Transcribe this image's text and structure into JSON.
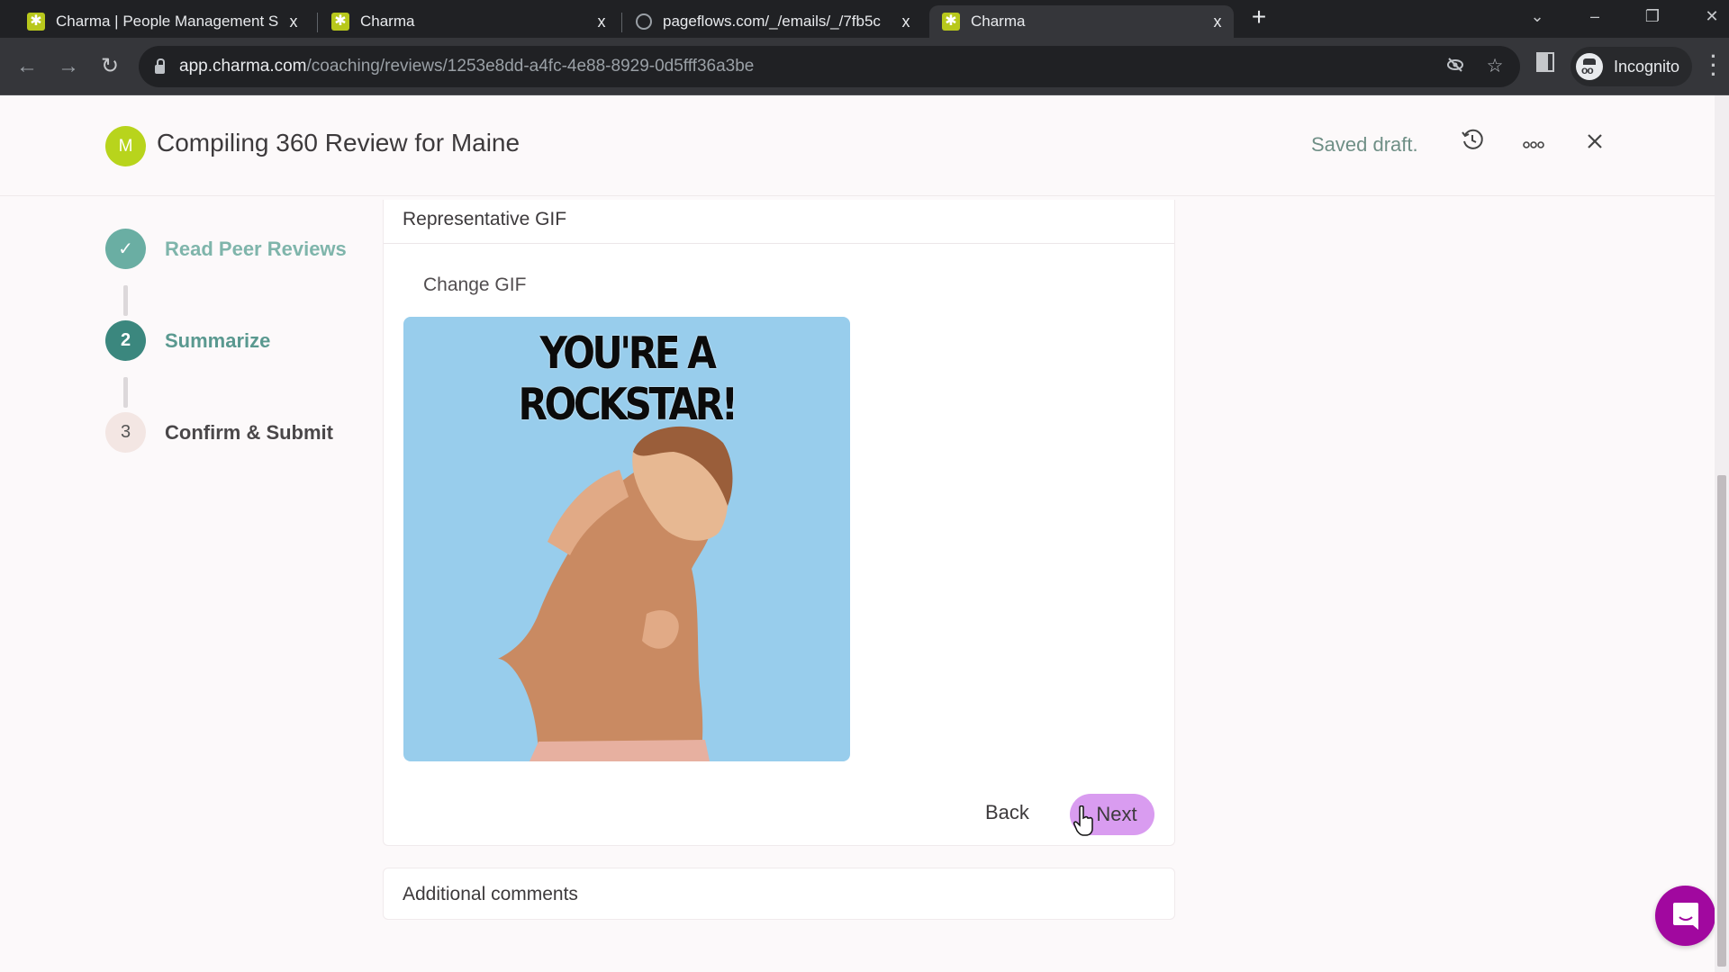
{
  "browser": {
    "tabs": [
      {
        "title": "Charma | People Management S",
        "favicon": "charma-logo-icon",
        "active": false
      },
      {
        "title": "Charma",
        "favicon": "charma-logo-icon",
        "active": false
      },
      {
        "title": "pageflows.com/_/emails/_/7fb5c",
        "favicon": "globe-icon",
        "active": false
      },
      {
        "title": "Charma",
        "favicon": "charma-logo-icon",
        "active": true
      }
    ],
    "close_glyph": "x",
    "new_tab_glyph": "+",
    "url_host": "app.charma.com",
    "url_path": "/coaching/reviews/1253e8dd-a4fc-4e88-8929-0d5fff36a3be",
    "profile_label": "Incognito"
  },
  "header": {
    "avatar_initial": "M",
    "title": "Compiling 360 Review for Maine",
    "status": "Saved draft."
  },
  "steps": [
    {
      "marker": "✓",
      "label": "Read Peer Reviews",
      "state": "done"
    },
    {
      "marker": "2",
      "label": "Summarize",
      "state": "current"
    },
    {
      "marker": "3",
      "label": "Confirm & Submit",
      "state": "todo"
    }
  ],
  "gif_section": {
    "title": "Representative GIF",
    "change_label": "Change GIF",
    "gif_caption": "YOU'RE A ROCKSTAR!",
    "back_label": "Back",
    "next_label": "Next"
  },
  "comments_section": {
    "title": "Additional comments"
  },
  "colors": {
    "accent_teal": "#3b877e",
    "next_button": "#d99cf0",
    "chat_button": "#a1089f",
    "avatar": "#b8d41c"
  }
}
